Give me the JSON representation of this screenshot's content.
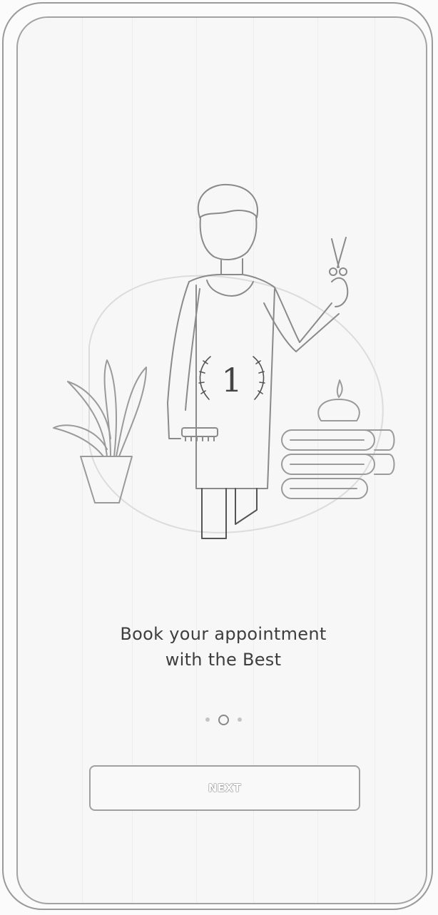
{
  "onboarding": {
    "headline_line1": "Book your appointment",
    "headline_line2": "with the Best",
    "badge_number": "1",
    "pager": {
      "total": 3,
      "active": 2
    },
    "next_label": "NEXT"
  },
  "colors": {
    "background": "#f7f7f7",
    "line_art": "#8a8a8a",
    "text": "#3e3e3e"
  }
}
